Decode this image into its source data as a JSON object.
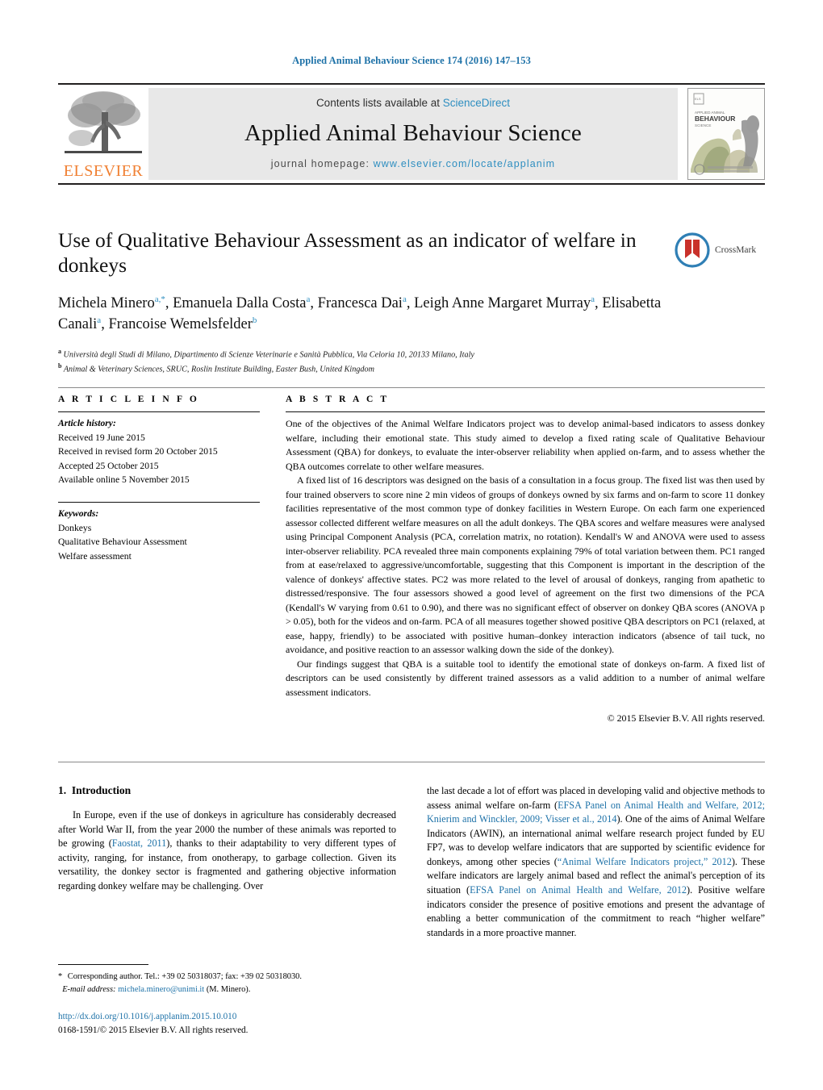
{
  "running_head": "Applied Animal Behaviour Science 174 (2016) 147–153",
  "masthead": {
    "contents_prefix": "Contents lists available at ",
    "contents_link": "ScienceDirect",
    "journal_title": "Applied Animal Behaviour Science",
    "homepage_prefix": "journal homepage: ",
    "homepage_url": "www.elsevier.com/locate/applanim",
    "publisher_name": "ELSEVIER",
    "cover_title_line1": "APPLIED ANIMAL",
    "cover_title_line2": "BEHAVIOUR",
    "cover_title_line3": "SCIENCE"
  },
  "article": {
    "title": "Use of Qualitative Behaviour Assessment as an indicator of welfare in donkeys",
    "crossmark_label": "CrossMark",
    "authors_html": "Michela Minero<sup>a,*</sup>, Emanuela Dalla Costa<sup>a</sup>, Francesca Dai<sup>a</sup>, Leigh Anne Margaret Murray<sup>a</sup>, Elisabetta Canali<sup>a</sup>, Francoise Wemelsfelder<sup>b</sup>",
    "affiliations": [
      {
        "marker": "a",
        "text": "Università degli Studi di Milano, Dipartimento di Scienze Veterinarie e Sanità Pubblica, Via Celoria 10, 20133 Milano, Italy"
      },
      {
        "marker": "b",
        "text": "Animal & Veterinary Sciences, SRUC, Roslin Institute Building, Easter Bush, United Kingdom"
      }
    ]
  },
  "article_info": {
    "heading": "A R T I C L E    I N F O",
    "history_label": "Article history:",
    "history": [
      "Received 19 June 2015",
      "Received in revised form 20 October 2015",
      "Accepted 25 October 2015",
      "Available online 5 November 2015"
    ],
    "keywords_label": "Keywords:",
    "keywords": [
      "Donkeys",
      "Qualitative Behaviour Assessment",
      "Welfare assessment"
    ]
  },
  "abstract": {
    "heading": "A B S T R A C T",
    "paragraphs": [
      "One of the objectives of the Animal Welfare Indicators project was to develop animal-based indicators to assess donkey welfare, including their emotional state. This study aimed to develop a fixed rating scale of Qualitative Behaviour Assessment (QBA) for donkeys, to evaluate the inter-observer reliability when applied on-farm, and to assess whether the QBA outcomes correlate to other welfare measures.",
      "A fixed list of 16 descriptors was designed on the basis of a consultation in a focus group. The fixed list was then used by four trained observers to score nine 2 min videos of groups of donkeys owned by six farms and on-farm to score 11 donkey facilities representative of the most common type of donkey facilities in Western Europe. On each farm one experienced assessor collected different welfare measures on all the adult donkeys. The QBA scores and welfare measures were analysed using Principal Component Analysis (PCA, correlation matrix, no rotation). Kendall's W and ANOVA were used to assess inter-observer reliability. PCA revealed three main components explaining 79% of total variation between them. PC1 ranged from at ease/relaxed to aggressive/uncomfortable, suggesting that this Component is important in the description of the valence of donkeys' affective states. PC2 was more related to the level of arousal of donkeys, ranging from apathetic to distressed/responsive. The four assessors showed a good level of agreement on the first two dimensions of the PCA (Kendall's W varying from 0.61 to 0.90), and there was no significant effect of observer on donkey QBA scores (ANOVA p > 0.05), both for the videos and on-farm. PCA of all measures together showed positive QBA descriptors on PC1 (relaxed, at ease, happy, friendly) to be associated with positive human–donkey interaction indicators (absence of tail tuck, no avoidance, and positive reaction to an assessor walking down the side of the donkey).",
      "Our findings suggest that QBA is a suitable tool to identify the emotional state of donkeys on-farm. A fixed list of descriptors can be used consistently by different trained assessors as a valid addition to a number of animal welfare assessment indicators."
    ],
    "copyright": "© 2015 Elsevier B.V. All rights reserved."
  },
  "introduction": {
    "section_number": "1.",
    "section_title": "Introduction",
    "left_paragraph_html": "In Europe, even if the use of donkeys in agriculture has considerably decreased after World War II, from the year 2000 the number of these animals was reported to be growing (<span class=\"lnk\">Faostat, 2011</span>), thanks to their adaptability to very different types of activity, ranging, for instance, from onotherapy, to garbage collection. Given its versatility, the donkey sector is fragmented and gathering objective information regarding donkey welfare may be challenging. Over",
    "right_paragraph_html": "the last decade a lot of effort was placed in developing valid and objective methods to assess animal welfare on-farm (<span class=\"lnk\">EFSA Panel on Animal Health and Welfare, 2012; Knierim and Winckler, 2009; Visser et al., 2014</span>). One of the aims of Animal Welfare Indicators (AWIN), an international animal welfare research project funded by EU FP7, was to develop welfare indicators that are supported by scientific evidence for donkeys, among other species (<span class=\"lnk\">&ldquo;Animal Welfare Indicators project,&rdquo; 2012</span>). These welfare indicators are largely animal based and reflect the animal's perception of its situation (<span class=\"lnk\">EFSA Panel on Animal Health and Welfare, 2012</span>). Positive welfare indicators consider the presence of positive emotions and present the advantage of enabling a better communication of the commitment to reach &ldquo;higher welfare&rdquo; standards in a more proactive manner."
  },
  "footnote": {
    "corresponding_html": "<span class=\"star\">*</span> Corresponding author. Tel.: +39 02 50318037; fax: +39 02 50318030.",
    "email_label": "E-mail address:",
    "email": "michela.minero@unimi.it",
    "email_suffix": "(M. Minero)."
  },
  "footer": {
    "doi_url": "http://dx.doi.org/10.1016/j.applanim.2015.10.010",
    "issn_line": "0168-1591/© 2015 Elsevier B.V. All rights reserved."
  },
  "colors": {
    "link_blue": "#1e72a8",
    "sciencedirect_blue": "#2e8ec0",
    "elsevier_orange": "#f08033",
    "masthead_grey": "#e8e8e8"
  }
}
